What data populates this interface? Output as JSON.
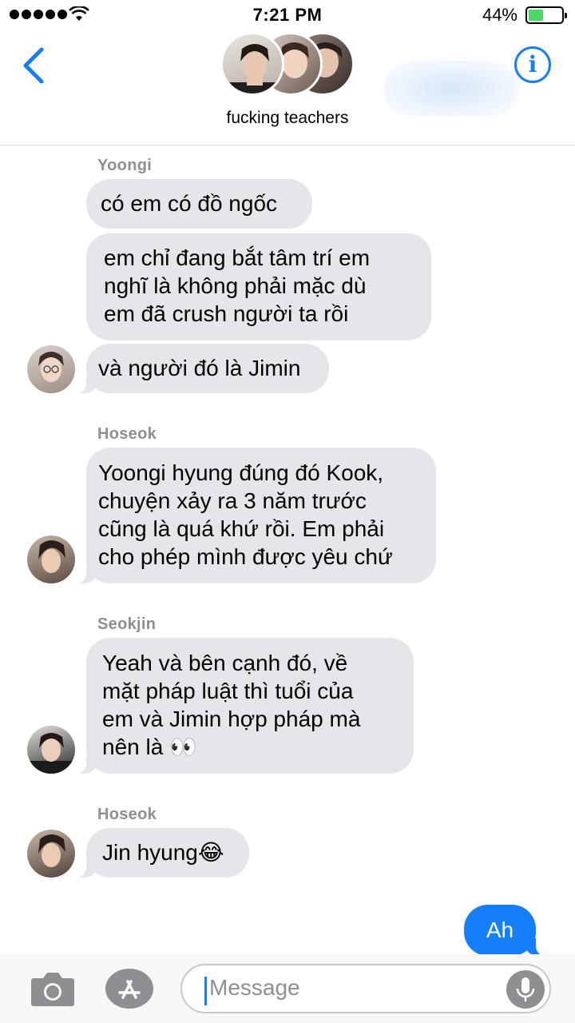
{
  "status_bar": {
    "time": "7:21 PM",
    "battery_percent": "44%",
    "battery_level": 0.44,
    "signal_bars": 5
  },
  "header": {
    "group_name": "fucking teachers",
    "back_icon": "chevron-left-icon",
    "info_icon": "info-icon",
    "info_glyph": "i"
  },
  "messages": [
    {
      "sender": "Yoongi",
      "bubbles": [
        "có em có đồ ngốc",
        "em chỉ đang bắt tâm trí em\nnghĩ là không phải mặc dù\nem đã crush người ta rồi",
        "và người đó là Jimin"
      ]
    },
    {
      "sender": "Hoseok",
      "bubbles": [
        "Yoongi hyung đúng đó Kook,\nchuyện xảy ra 3 năm trước\ncũng là quá khứ rồi. Em phải\ncho phép mình được yêu chứ"
      ]
    },
    {
      "sender": "Seokjin",
      "bubbles": [
        "Yeah và bên cạnh đó, về\nmặt pháp luật thì tuổi của\nem và Jimin hợp pháp mà\nnên là 👀"
      ]
    },
    {
      "sender": "Hoseok",
      "bubbles": [
        "Jin hyung😂"
      ]
    }
  ],
  "outgoing": {
    "text": "Ah"
  },
  "compose": {
    "placeholder": "Message",
    "camera_icon": "camera-icon",
    "apps_icon": "app-store-icon",
    "mic_icon": "microphone-icon"
  },
  "colors": {
    "accent": "#157efb",
    "incoming_bubble": "#e5e5ea",
    "sender_label": "#8e8e93"
  }
}
